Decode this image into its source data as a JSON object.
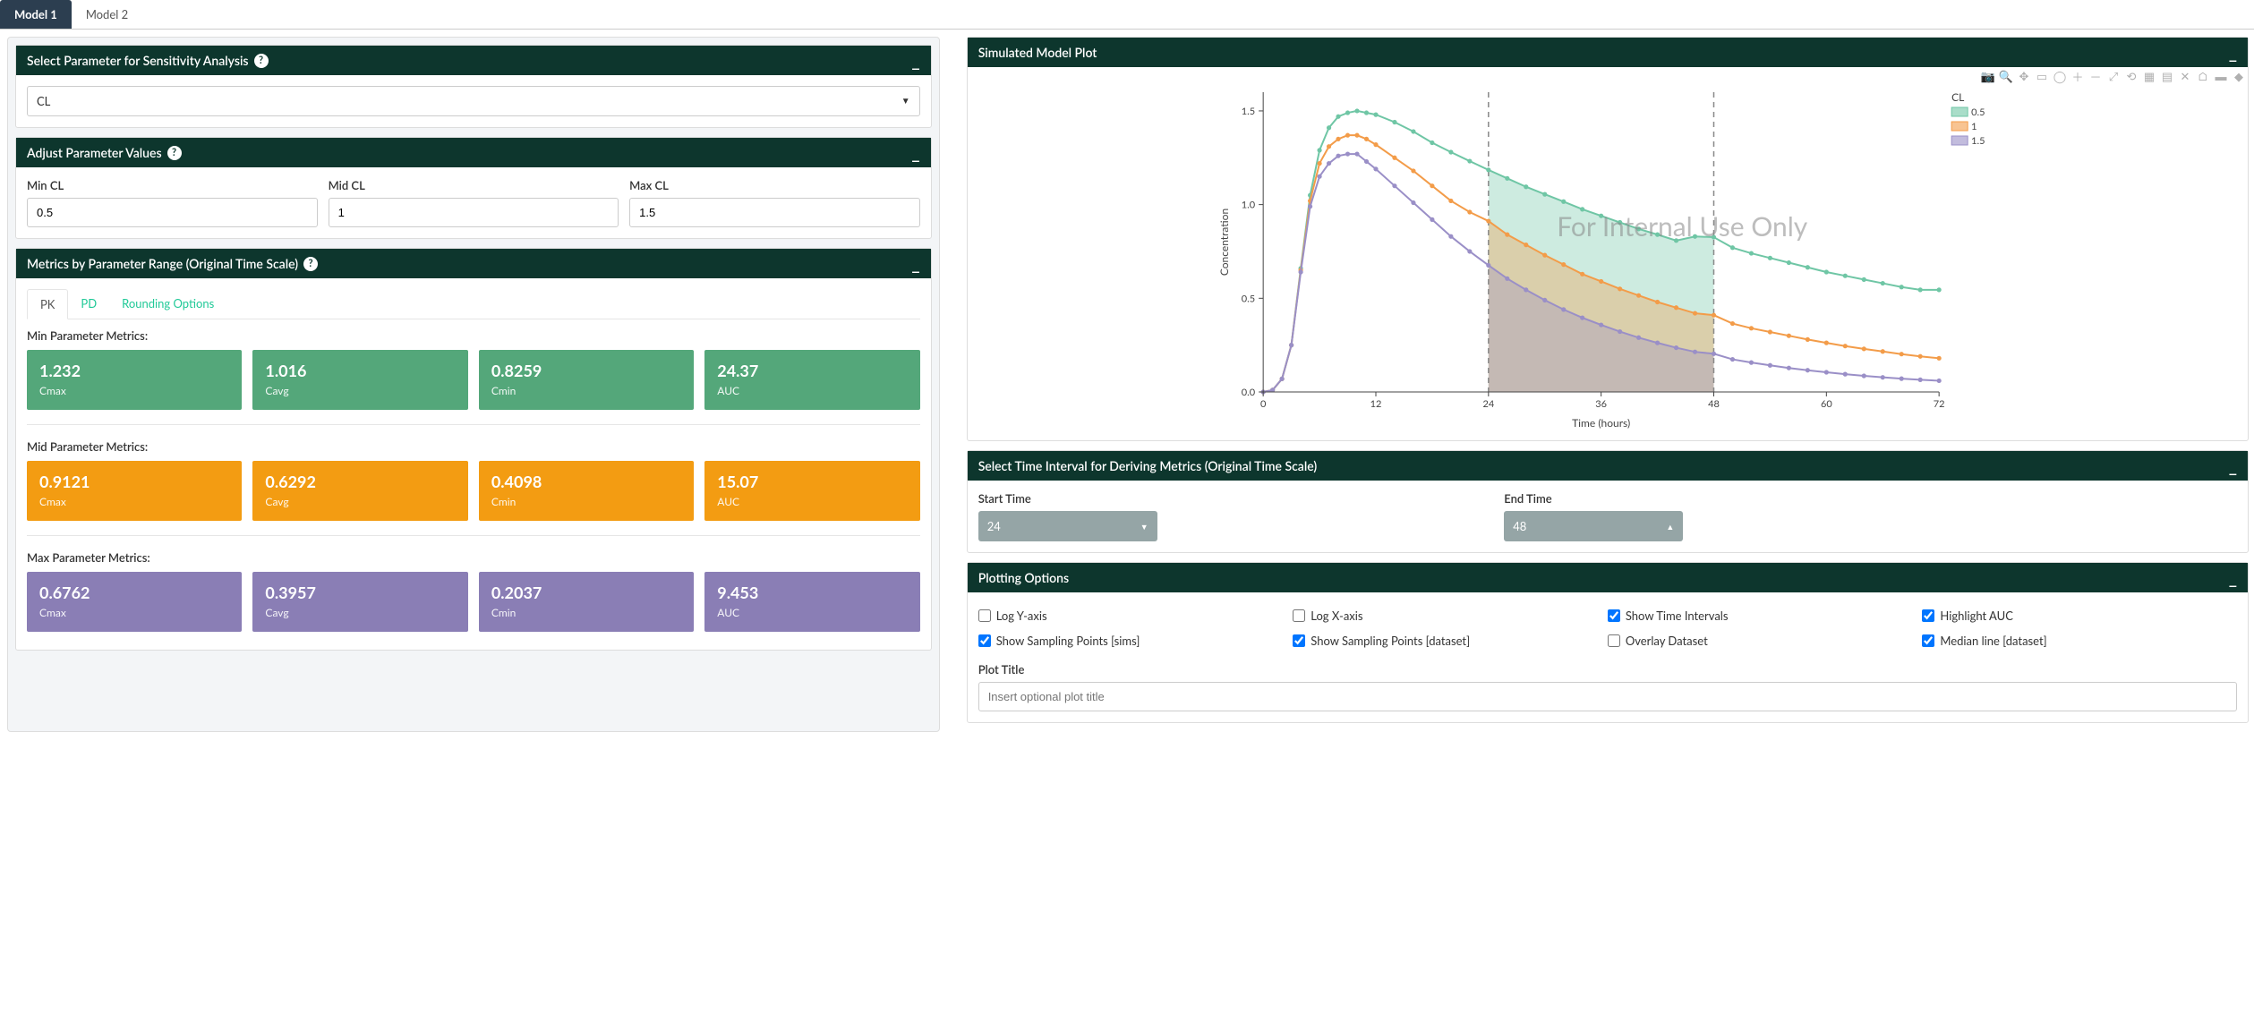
{
  "tabs": [
    "Model 1",
    "Model 2"
  ],
  "active_tab": 0,
  "left": {
    "select_param": {
      "title": "Select Parameter for Sensitivity Analysis",
      "value": "CL"
    },
    "adjust": {
      "title": "Adjust Parameter Values",
      "min_label": "Min CL",
      "mid_label": "Mid CL",
      "max_label": "Max CL",
      "min_val": "0.5",
      "mid_val": "1",
      "max_val": "1.5"
    },
    "metrics_panel": {
      "title": "Metrics by Parameter Range (Original Time Scale)",
      "sub_tabs": [
        "PK",
        "PD",
        "Rounding Options"
      ],
      "active_sub_tab": 0,
      "groups": [
        {
          "title": "Min Parameter Metrics:",
          "color": "mc-green",
          "cards": [
            {
              "value": "1.232",
              "label": "Cmax"
            },
            {
              "value": "1.016",
              "label": "Cavg"
            },
            {
              "value": "0.8259",
              "label": "Cmin"
            },
            {
              "value": "24.37",
              "label": "AUC"
            }
          ]
        },
        {
          "title": "Mid Parameter Metrics:",
          "color": "mc-orange",
          "cards": [
            {
              "value": "0.9121",
              "label": "Cmax"
            },
            {
              "value": "0.6292",
              "label": "Cavg"
            },
            {
              "value": "0.4098",
              "label": "Cmin"
            },
            {
              "value": "15.07",
              "label": "AUC"
            }
          ]
        },
        {
          "title": "Max Parameter Metrics:",
          "color": "mc-purple",
          "cards": [
            {
              "value": "0.6762",
              "label": "Cmax"
            },
            {
              "value": "0.3957",
              "label": "Cavg"
            },
            {
              "value": "0.2037",
              "label": "Cmin"
            },
            {
              "value": "9.453",
              "label": "AUC"
            }
          ]
        }
      ]
    }
  },
  "right": {
    "plot_panel_title": "Simulated Model Plot",
    "time_panel": {
      "title": "Select Time Interval for Deriving Metrics (Original Time Scale)",
      "start_label": "Start Time",
      "end_label": "End Time",
      "start_value": "24",
      "end_value": "48"
    },
    "options_panel": {
      "title": "Plotting Options",
      "opts": [
        {
          "label": "Log Y-axis",
          "checked": false
        },
        {
          "label": "Log X-axis",
          "checked": false
        },
        {
          "label": "Show Time Intervals",
          "checked": true
        },
        {
          "label": "Highlight AUC",
          "checked": true
        },
        {
          "label": "Show Sampling Points [sims]",
          "checked": true
        },
        {
          "label": "Show Sampling Points [dataset]",
          "checked": true
        },
        {
          "label": "Overlay Dataset",
          "checked": false
        },
        {
          "label": "Median line [dataset]",
          "checked": true
        }
      ],
      "plot_title_label": "Plot Title",
      "plot_title_placeholder": "Insert optional plot title"
    }
  },
  "chart_data": {
    "type": "line",
    "xlabel": "Time (hours)",
    "ylabel": "Concentration",
    "watermark": "For Internal Use Only",
    "legend_title": "CL",
    "xlim": [
      0,
      72
    ],
    "ylim": [
      0,
      1.6
    ],
    "xticks": [
      0,
      12,
      24,
      36,
      48,
      60,
      72
    ],
    "yticks": [
      0.0,
      0.5,
      1.0,
      1.5
    ],
    "shade_interval": [
      24,
      48
    ],
    "series": [
      {
        "name": "0.5",
        "color": "#6fc6a5",
        "x": [
          0,
          1,
          2,
          3,
          4,
          5,
          6,
          7,
          8,
          9,
          10,
          11,
          12,
          14,
          16,
          18,
          20,
          22,
          24,
          26,
          28,
          30,
          32,
          34,
          36,
          38,
          40,
          42,
          44,
          46,
          48,
          50,
          52,
          54,
          56,
          58,
          60,
          62,
          64,
          66,
          68,
          70,
          72
        ],
        "y": [
          0.0,
          0.01,
          0.07,
          0.25,
          0.66,
          1.05,
          1.29,
          1.41,
          1.47,
          1.49,
          1.5,
          1.49,
          1.48,
          1.44,
          1.39,
          1.33,
          1.28,
          1.232,
          1.185,
          1.14,
          1.095,
          1.055,
          1.016,
          0.975,
          0.94,
          0.905,
          0.87,
          0.84,
          0.808,
          0.83,
          0.826,
          0.77,
          0.74,
          0.715,
          0.69,
          0.665,
          0.64,
          0.62,
          0.6,
          0.58,
          0.56,
          0.545,
          0.545
        ],
        "auc_24_48": 24.37
      },
      {
        "name": "1",
        "color": "#f39c49",
        "x": [
          0,
          1,
          2,
          3,
          4,
          5,
          6,
          7,
          8,
          9,
          10,
          11,
          12,
          14,
          16,
          18,
          20,
          22,
          24,
          26,
          28,
          30,
          32,
          34,
          36,
          38,
          40,
          42,
          44,
          46,
          48,
          50,
          52,
          54,
          56,
          58,
          60,
          62,
          64,
          66,
          68,
          70,
          72
        ],
        "y": [
          0.0,
          0.01,
          0.07,
          0.25,
          0.65,
          1.02,
          1.22,
          1.31,
          1.35,
          1.37,
          1.37,
          1.35,
          1.32,
          1.25,
          1.18,
          1.1,
          1.02,
          0.96,
          0.912,
          0.84,
          0.785,
          0.73,
          0.68,
          0.629,
          0.59,
          0.55,
          0.515,
          0.48,
          0.45,
          0.42,
          0.41,
          0.365,
          0.34,
          0.32,
          0.3,
          0.28,
          0.262,
          0.245,
          0.23,
          0.216,
          0.202,
          0.19,
          0.18
        ],
        "auc_24_48": 15.07
      },
      {
        "name": "1.5",
        "color": "#9a8fc7",
        "x": [
          0,
          1,
          2,
          3,
          4,
          5,
          6,
          7,
          8,
          9,
          10,
          11,
          12,
          14,
          16,
          18,
          20,
          22,
          24,
          26,
          28,
          30,
          32,
          34,
          36,
          38,
          40,
          42,
          44,
          46,
          48,
          50,
          52,
          54,
          56,
          58,
          60,
          62,
          64,
          66,
          68,
          70,
          72
        ],
        "y": [
          0.0,
          0.01,
          0.07,
          0.25,
          0.64,
          0.99,
          1.15,
          1.22,
          1.26,
          1.27,
          1.27,
          1.23,
          1.19,
          1.1,
          1.01,
          0.92,
          0.83,
          0.75,
          0.676,
          0.605,
          0.545,
          0.49,
          0.44,
          0.396,
          0.358,
          0.322,
          0.29,
          0.262,
          0.236,
          0.214,
          0.204,
          0.174,
          0.157,
          0.142,
          0.128,
          0.116,
          0.105,
          0.095,
          0.086,
          0.078,
          0.071,
          0.065,
          0.06
        ],
        "auc_24_48": 9.453
      }
    ]
  },
  "modebar_icons": [
    "camera",
    "zoom",
    "pan",
    "select",
    "lasso",
    "zoom-in",
    "zoom-out",
    "autoscale",
    "reset",
    "toggle",
    "spike",
    "spike2",
    "home",
    "toggle2",
    "logo"
  ]
}
